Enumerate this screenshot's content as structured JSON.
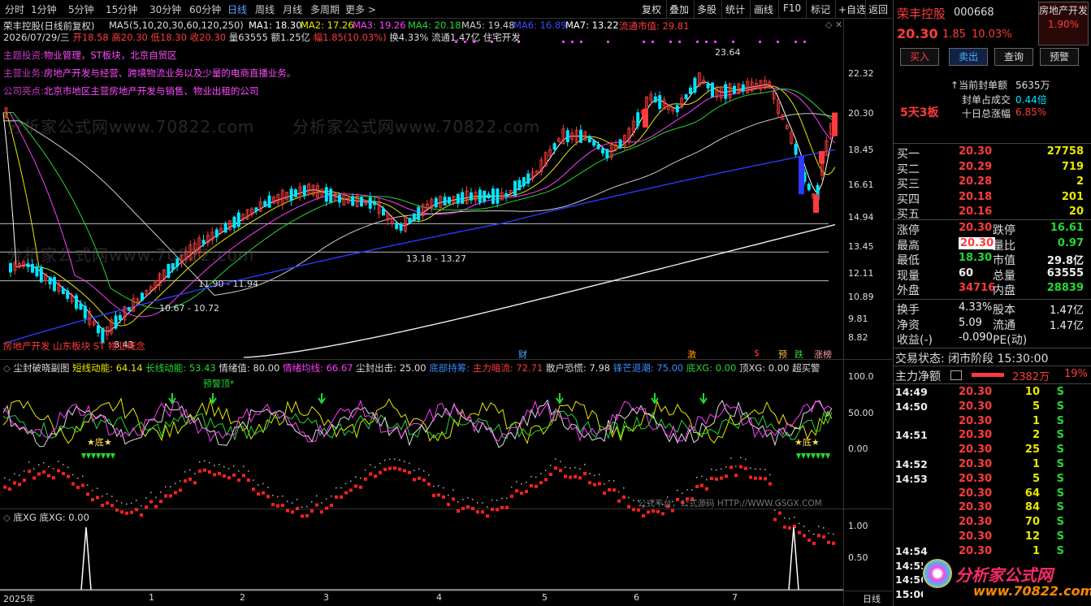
{
  "toolbar": {
    "tabs": [
      "分时",
      "1分钟",
      "5分钟",
      "15分钟",
      "30分钟",
      "60分钟",
      "日线",
      "周线",
      "月线",
      "多周期",
      "更多 >"
    ],
    "active_tab": "日线",
    "right_buttons": [
      "复权",
      "叠加",
      "多股",
      "统计",
      "画线",
      "F10",
      "标记",
      "+自选",
      "返回"
    ]
  },
  "chart": {
    "title": "荣丰控股(日线前复权)",
    "ma_legend": {
      "params": "MA5(5,10,20,30,60,120,250)",
      "ma1": "MA1: 18.30",
      "ma2": "MA2: 17.26",
      "ma3": "MA3: 19.26",
      "ma4": "MA4: 20.18",
      "ma5": "MA5: 19.48",
      "ma6": "MA6: 16.89",
      "ma7": "MA7: 13.22",
      "float_cap": "流通市值: 29.81"
    },
    "quote_line": {
      "date": "2026/07/29/三",
      "open": "开18.58",
      "high": "高20.30",
      "low": "低18.30",
      "close": "收20.30",
      "volume": "量63555",
      "amount": "额1.25亿",
      "change": "幅1.85(10.03%)",
      "turnover": "换4.33%",
      "float": "流通1.47亿",
      "sector": "住宅开发"
    },
    "info_lines": [
      {
        "label": "主题投资:",
        "text": "物业管理，ST板块，北京自贸区"
      },
      {
        "label": "主营业务:",
        "text": "房地产开发与经营、跨境物流业务以及少量的电商直播业务。"
      },
      {
        "label": "公司亮点:",
        "text": "北京市地区主营房地产开发与销售、物业出租的公司"
      }
    ],
    "y_ticks": [
      "22.32",
      "20.30",
      "18.45",
      "16.61",
      "14.94",
      "13.45",
      "12.11",
      "10.89",
      "9.81",
      "8.82"
    ],
    "annotations": [
      "23.64",
      "13.18 - 13.27",
      "11.90 - 11.94",
      "10.67 - 10.72",
      "8.43"
    ],
    "concept_text": "房地产开发  山东板块  ST  物业概念",
    "event_tags": [
      "财",
      "激",
      "$",
      "预",
      "跌",
      "涨榜"
    ],
    "watermarks": [
      "分析家公式网www.70822.com",
      "分析家公式网www.70822.com",
      "分析家公式网www.70822.com"
    ]
  },
  "sub1": {
    "title": "尘封破晓副图",
    "items": [
      {
        "label": "短线动能:",
        "value": "64.14"
      },
      {
        "label": "长线动能:",
        "value": "53.43"
      },
      {
        "label": "情绪值:",
        "value": "80.00"
      },
      {
        "label": "情绪均线:",
        "value": "66.67"
      },
      {
        "label": "尘封出击:",
        "value": "25.00"
      },
      {
        "label": "底部持筹:",
        "value": ""
      },
      {
        "label": "主力暗流:",
        "value": "72.71"
      },
      {
        "label": "散户恐慌:",
        "value": "7.98"
      },
      {
        "label": "锋芒退潮:",
        "value": "75.00"
      },
      {
        "label": "底XG:",
        "value": "0.00"
      },
      {
        "label": "顶XG:",
        "value": "0.00"
      },
      {
        "label": "超买警",
        "value": ""
      }
    ],
    "y_ticks": [
      "100.0",
      "50.00",
      "0.00"
    ],
    "marks": [
      "预警顶*",
      "★底★",
      "★底★"
    ],
    "footer": "公式平台，公式源码 HTTP://WWW.GSGX.COM"
  },
  "sub2": {
    "title": "底XG",
    "item": "底XG: 0.00",
    "y_ticks": [
      "1.00",
      "0.50"
    ]
  },
  "xaxis": {
    "labels": [
      "2025年",
      "1",
      "2",
      "3",
      "4",
      "5",
      "6",
      "7"
    ],
    "period": "日线"
  },
  "stock": {
    "name": "荣丰控股",
    "code": "000668",
    "tag": "房地产开发",
    "tag_pct": "1.90%",
    "price": "20.30",
    "change": "1.85",
    "change_pct": "10.03%",
    "buttons": [
      "买入",
      "卖出",
      "查询",
      "预警"
    ],
    "board_streak": "5天3板",
    "seal_amount_label": "当前封单额",
    "seal_amount": "5635万",
    "seal_ratio_label": "封单占成交",
    "seal_ratio": "0.44倍",
    "ten_day_label": "十日总涨幅",
    "ten_day": "6.85%"
  },
  "order_book": [
    {
      "label": "买一",
      "price": "20.30",
      "vol": "27758"
    },
    {
      "label": "买二",
      "price": "20.29",
      "vol": "719"
    },
    {
      "label": "买三",
      "price": "20.28",
      "vol": "2"
    },
    {
      "label": "买四",
      "price": "20.18",
      "vol": "201"
    },
    {
      "label": "买五",
      "price": "20.16",
      "vol": "20"
    }
  ],
  "stats": [
    {
      "l1": "涨停",
      "v1": "20.30",
      "c1": "red",
      "l2": "跌停",
      "v2": "16.61",
      "c2": "green"
    },
    {
      "l1": "最高",
      "v1": "20.30",
      "c1": "red",
      "l2": "量比",
      "v2": "0.97",
      "c2": "green"
    },
    {
      "l1": "最低",
      "v1": "18.30",
      "c1": "green",
      "l2": "市值",
      "v2": "29.8亿",
      "c2": "white"
    },
    {
      "l1": "现量",
      "v1": "60",
      "c1": "white",
      "l2": "总量",
      "v2": "63555",
      "c2": "white"
    },
    {
      "l1": "外盘",
      "v1": "34716",
      "c1": "red",
      "l2": "内盘",
      "v2": "28839",
      "c2": "green"
    }
  ],
  "fundamentals": [
    {
      "l1": "换手",
      "v1": "4.33%",
      "l2": "股本",
      "v2": "1.47亿"
    },
    {
      "l1": "净资",
      "v1": "5.09",
      "l2": "流通",
      "v2": "1.47亿"
    },
    {
      "l1": "收益(-)",
      "v1": "-0.090",
      "l2": "PE(动)",
      "v2": ""
    }
  ],
  "trade_status": "交易状态: 闭市阶段 15:30:00",
  "main_net": {
    "label": "主力净额",
    "value": "2382万",
    "pct": "19%"
  },
  "ticks": [
    {
      "time": "14:49",
      "price": "20.30",
      "vol": "10",
      "side": "S"
    },
    {
      "time": "14:50",
      "price": "20.30",
      "vol": "5",
      "side": "S"
    },
    {
      "time": "",
      "price": "20.30",
      "vol": "1",
      "side": "S"
    },
    {
      "time": "14:51",
      "price": "20.30",
      "vol": "2",
      "side": "S"
    },
    {
      "time": "",
      "price": "20.30",
      "vol": "25",
      "side": "S"
    },
    {
      "time": "14:52",
      "price": "20.30",
      "vol": "1",
      "side": "S"
    },
    {
      "time": "14:53",
      "price": "20.30",
      "vol": "5",
      "side": "S"
    },
    {
      "time": "",
      "price": "20.30",
      "vol": "64",
      "side": "S"
    },
    {
      "time": "",
      "price": "20.30",
      "vol": "84",
      "side": "S"
    },
    {
      "time": "",
      "price": "20.30",
      "vol": "70",
      "side": "S"
    },
    {
      "time": "",
      "price": "20.30",
      "vol": "12",
      "side": "S"
    },
    {
      "time": "14:54",
      "price": "20.30",
      "vol": "1",
      "side": "S"
    },
    {
      "time": "14:55",
      "price": "",
      "vol": "",
      "side": ""
    },
    {
      "time": "14:56",
      "price": "",
      "vol": "",
      "side": ""
    },
    {
      "time": "15:00",
      "price": "",
      "vol": "",
      "side": ""
    }
  ],
  "logo": {
    "text": "分析家公式网",
    "url": "www.70822.com"
  },
  "colors": {
    "up": "#ff3b3b",
    "down": "#00e5ff",
    "ma1": "#ffffff",
    "ma2": "#e8e800",
    "ma3": "#ff3cff",
    "ma4": "#23d833",
    "ma5": "#cccccc",
    "ma6": "#2b3bff",
    "ma7": "#ffffff"
  }
}
